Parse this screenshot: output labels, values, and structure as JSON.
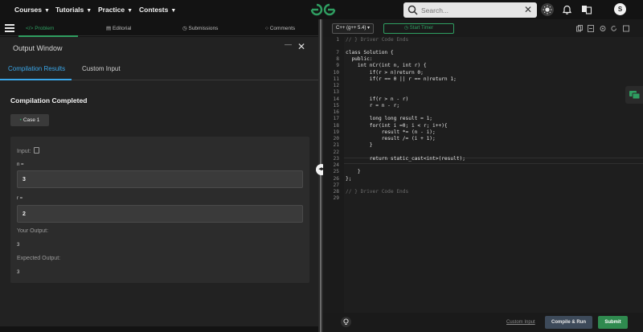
{
  "topnav": {
    "items": [
      {
        "label": "Courses"
      },
      {
        "label": "Tutorials"
      },
      {
        "label": "Practice"
      },
      {
        "label": "Contests"
      }
    ],
    "search_placeholder": "Search...",
    "avatar_letter": "S"
  },
  "problem_tabs": [
    {
      "label": "Problem",
      "icon": "code-icon",
      "active": true
    },
    {
      "label": "Editorial",
      "icon": "document-icon"
    },
    {
      "label": "Submissions",
      "icon": "clock-icon"
    },
    {
      "label": "Comments",
      "icon": "comment-icon"
    }
  ],
  "output_window": {
    "title": "Output Window",
    "tabs": [
      {
        "label": "Compilation Results",
        "active": true
      },
      {
        "label": "Custom Input"
      }
    ],
    "status": "Compilation Completed",
    "case_label": "Case 1",
    "input_label": "Input:",
    "param_n_label": "n =",
    "param_n_value": "3",
    "param_r_label": "r =",
    "param_r_value": "2",
    "your_output_label": "Your Output:",
    "your_output_value": "3",
    "expected_output_label": "Expected Output:",
    "expected_output_value": "3"
  },
  "editor": {
    "language": "C++ (g++ 5.4)",
    "timer_label": "Start Timer",
    "line_numbers": [
      "1",
      "7",
      "8",
      "9",
      "10",
      "11",
      "12",
      "13",
      "14",
      "15",
      "16",
      "17",
      "18",
      "19",
      "20",
      "21",
      "22",
      "23",
      "24",
      "25",
      "26",
      "27",
      "28",
      "29"
    ],
    "code_lines": [
      "// } Driver Code Ends",
      "",
      "class Solution {",
      "  public:",
      "    int nCr(int n, int r) {",
      "        if(r > n)return 0;",
      "        if(r == 0 || r == n)return 1;",
      "",
      "",
      "        if(r > n - r)",
      "        r = n - r;",
      "",
      "        long long result = 1;",
      "        for(int i =0; i < r; i++){",
      "            result *= (n - i);",
      "            result /= (i + 1);",
      "        }",
      "",
      "        return static_cast<int>(result);",
      "",
      "    }",
      "};",
      "",
      "// } Driver Code Ends"
    ]
  },
  "bottom": {
    "custom_input_label": "Custom Input",
    "compile_run_label": "Compile & Run",
    "submit_label": "Submit"
  },
  "colors": {
    "accent_green": "#2f9e61",
    "accent_blue": "#3aa6e8",
    "background": "#131313"
  }
}
